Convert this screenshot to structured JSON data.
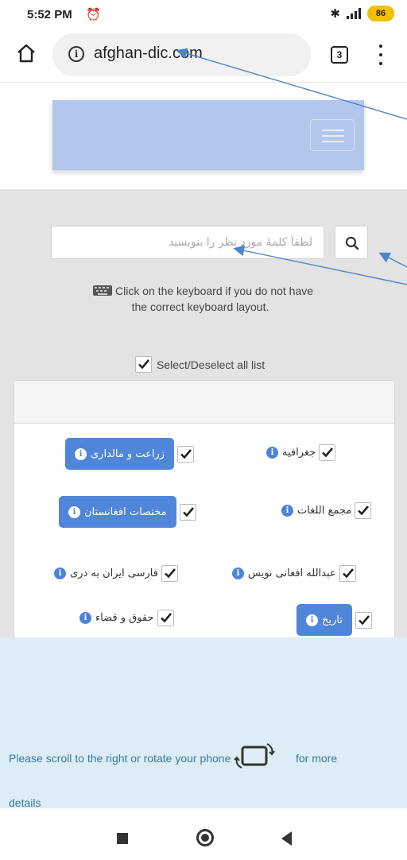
{
  "status_bar": {
    "time": "5:52 PM",
    "alarm_icon": "alarm-off-icon",
    "battery": "86"
  },
  "browser": {
    "url": "afghan-dic.com",
    "tab_count": "3"
  },
  "search": {
    "placeholder": "لطفاً کلمهٔ مورد نظر را بنویسید"
  },
  "keyboard_hint": {
    "line1": "Click on the keyboard if you do not have",
    "line2": "the correct keyboard layout."
  },
  "select_all_label": "Select/Deselect all list",
  "dictionaries": [
    {
      "label": "جغرافیه",
      "checked": true,
      "highlighted": false
    },
    {
      "label": "زراعت و مالداری",
      "checked": true,
      "highlighted": true
    },
    {
      "label": "مجمع اللغات",
      "checked": true,
      "highlighted": false
    },
    {
      "label": "مختصات افغانستان",
      "checked": true,
      "highlighted": true
    },
    {
      "label": "عبدالله افغانی نویس",
      "checked": true,
      "highlighted": false
    },
    {
      "label": "فارسی ایران به دری",
      "checked": true,
      "highlighted": false
    },
    {
      "label": "تاریخ",
      "checked": true,
      "highlighted": true
    },
    {
      "label": "حقوق و قضاء",
      "checked": true,
      "highlighted": false
    }
  ],
  "notice": {
    "line1": "Please scroll to the right or rotate your phone",
    "more": "for more",
    "line2": "details"
  },
  "colors": {
    "navbar": "#b3c7ec",
    "button": "#4f86d9",
    "notice_bg": "#dcedf5",
    "notice_text": "#3a7a9c",
    "arrow": "#4a86c8"
  }
}
